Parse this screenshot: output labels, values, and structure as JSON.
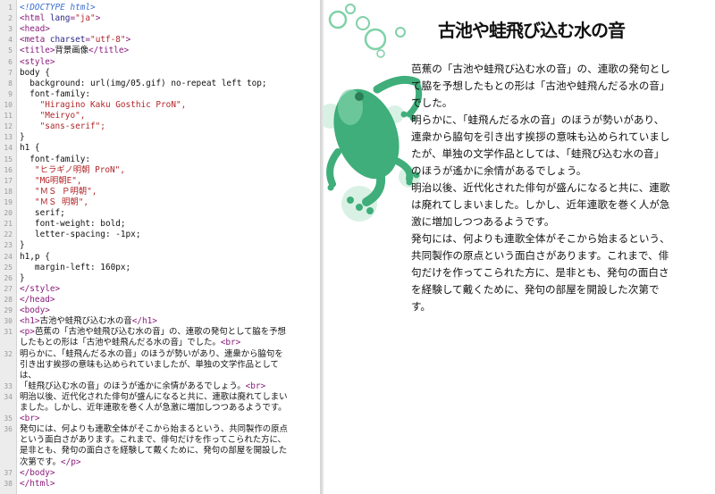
{
  "editor": {
    "lines": [
      {
        "n": "1",
        "parts": [
          [
            "doc",
            "<!DOCTYPE html>"
          ]
        ]
      },
      {
        "n": "2",
        "parts": [
          [
            "tag",
            "<html "
          ],
          [
            "attr",
            "lang"
          ],
          [
            "tag",
            "="
          ],
          [
            "str",
            "\"ja\""
          ],
          [
            "tag",
            ">"
          ]
        ]
      },
      {
        "n": "3",
        "parts": [
          [
            "tag",
            "<head>"
          ]
        ]
      },
      {
        "n": "4",
        "parts": [
          [
            "tag",
            "<meta "
          ],
          [
            "attr",
            "charset"
          ],
          [
            "tag",
            "="
          ],
          [
            "str",
            "\"utf-8\""
          ],
          [
            "tag",
            ">"
          ]
        ]
      },
      {
        "n": "5",
        "parts": [
          [
            "tag",
            "<title>"
          ],
          [
            "txt",
            "背景画像"
          ],
          [
            "tag",
            "</title>"
          ]
        ]
      },
      {
        "n": "6",
        "parts": [
          [
            "tag",
            "<style>"
          ]
        ]
      },
      {
        "n": "7",
        "parts": [
          [
            "sel",
            "body {"
          ]
        ]
      },
      {
        "n": "8",
        "parts": [
          [
            "prop",
            "  background: url(img/05.gif) no-repeat left top;"
          ]
        ]
      },
      {
        "n": "9",
        "parts": [
          [
            "prop",
            "  font-family:"
          ]
        ]
      },
      {
        "n": "10",
        "parts": [
          [
            "val",
            "    \"Hiragino Kaku Gosthic ProN\","
          ]
        ]
      },
      {
        "n": "11",
        "parts": [
          [
            "val",
            "    \"Meiryo\","
          ]
        ]
      },
      {
        "n": "12",
        "parts": [
          [
            "val",
            "    \"sans-serif\";"
          ]
        ]
      },
      {
        "n": "13",
        "parts": [
          [
            "sel",
            "}"
          ]
        ]
      },
      {
        "n": "14",
        "parts": [
          [
            "sel",
            "h1 {"
          ]
        ]
      },
      {
        "n": "15",
        "parts": [
          [
            "prop",
            "  font-family:"
          ]
        ]
      },
      {
        "n": "16",
        "parts": [
          [
            "val",
            "   \"ヒラギノ明朝 ProN\","
          ]
        ]
      },
      {
        "n": "17",
        "parts": [
          [
            "val",
            "   \"MG明朝E\","
          ]
        ]
      },
      {
        "n": "18",
        "parts": [
          [
            "val",
            "   \"ＭＳ Ｐ明朝\","
          ]
        ]
      },
      {
        "n": "19",
        "parts": [
          [
            "val",
            "   \"ＭＳ 明朝\","
          ]
        ]
      },
      {
        "n": "20",
        "parts": [
          [
            "prop",
            "   serif;"
          ]
        ]
      },
      {
        "n": "21",
        "parts": [
          [
            "prop",
            "   font-weight: bold;"
          ]
        ]
      },
      {
        "n": "22",
        "parts": [
          [
            "prop",
            "   letter-spacing: -1px;"
          ]
        ]
      },
      {
        "n": "23",
        "parts": [
          [
            "sel",
            "}"
          ]
        ]
      },
      {
        "n": "24",
        "parts": [
          [
            "sel",
            "h1,p {"
          ]
        ]
      },
      {
        "n": "25",
        "parts": [
          [
            "prop",
            "   margin-left: 160px;"
          ]
        ]
      },
      {
        "n": "26",
        "parts": [
          [
            "sel",
            "}"
          ]
        ]
      },
      {
        "n": "27",
        "parts": [
          [
            "tag",
            "</style>"
          ]
        ]
      },
      {
        "n": "28",
        "parts": [
          [
            "tag",
            "</head>"
          ]
        ]
      },
      {
        "n": "29",
        "parts": [
          [
            "tag",
            "<body>"
          ]
        ]
      },
      {
        "n": "30",
        "parts": [
          [
            "tag",
            "<h1>"
          ],
          [
            "txt",
            "古池や蛙飛び込む水の音"
          ],
          [
            "tag",
            "</h1>"
          ]
        ]
      },
      {
        "n": "31",
        "parts": [
          [
            "tag",
            "<p>"
          ],
          [
            "txt",
            "芭蕉の「古池や蛙飛び込む水の音」の、連歌の発句として脇を予想"
          ]
        ]
      },
      {
        "n": "",
        "parts": [
          [
            "txt",
            "したもとの形は「古池や蛙飛んだる水の音」でした。"
          ],
          [
            "tag",
            "<br>"
          ]
        ]
      },
      {
        "n": "32",
        "parts": [
          [
            "txt",
            "明らかに、「蛙飛んだる水の音」のほうが勢いがあり、連衆から脇句を"
          ]
        ]
      },
      {
        "n": "",
        "parts": [
          [
            "txt",
            "引き出す挨拶の意味も込められていましたが、単独の文学作品として"
          ]
        ]
      },
      {
        "n": "",
        "parts": [
          [
            "txt",
            "は、"
          ]
        ]
      },
      {
        "n": "33",
        "parts": [
          [
            "txt",
            "「蛙飛び込む水の音」のほうが遙かに余情があるでしょう。"
          ],
          [
            "tag",
            "<br>"
          ]
        ]
      },
      {
        "n": "34",
        "parts": [
          [
            "txt",
            "明治以後、近代化された俳句が盛んになると共に、連歌は廃れてしまい"
          ]
        ]
      },
      {
        "n": "",
        "parts": [
          [
            "txt",
            "ました。しかし、近年連歌を巻く人が急激に増加しつつあるようです。"
          ]
        ]
      },
      {
        "n": "35",
        "parts": [
          [
            "tag",
            "<br>"
          ]
        ]
      },
      {
        "n": "36",
        "parts": [
          [
            "txt",
            "発句には、何よりも連歌全体がそこから始まるという、共同製作の原点"
          ]
        ]
      },
      {
        "n": "",
        "parts": [
          [
            "txt",
            "という面白さがあります。これまで、俳句だけを作ってこられた方に、"
          ]
        ]
      },
      {
        "n": "",
        "parts": [
          [
            "txt",
            "是非とも、発句の面白さを経験して戴くために、発句の部屋を開設した"
          ]
        ]
      },
      {
        "n": "",
        "parts": [
          [
            "txt",
            "次第です。"
          ],
          [
            "tag",
            "</p>"
          ]
        ]
      },
      {
        "n": "37",
        "parts": [
          [
            "tag",
            "</body>"
          ]
        ]
      },
      {
        "n": "38",
        "parts": [
          [
            "tag",
            "</html>"
          ]
        ]
      }
    ]
  },
  "preview": {
    "heading": "古池や蛙飛び込む水の音",
    "paragraph_lines": [
      "芭蕉の「古池や蛙飛び込む水の音」の、連歌の発句とし",
      "て脇を予想したもとの形は「古池や蛙飛んだる水の音」",
      "でした。",
      "明らかに、「蛙飛んだる水の音」のほうが勢いがあり、",
      "連衆から脇句を引き出す挨拶の意味も込められていまし",
      "たが、単独の文学作品としては、「蛙飛び込む水の音」",
      "のほうが遙かに余情があるでしょう。",
      "明治以後、近代化された俳句が盛んになると共に、連歌",
      "は廃れてしまいました。しかし、近年連歌を巻く人が急",
      "激に増加しつつあるようです。",
      "発句には、何よりも連歌全体がそこから始まるという、",
      "共同製作の原点という面白さがあります。これまで、俳",
      "句だけを作ってこられた方に、是非とも、発句の面白さ",
      "を経験して戴くために、発句の部屋を開設した次第で",
      "す。"
    ],
    "frog_color": "#3fae7a",
    "bubble_color": "#7fd1a8"
  }
}
